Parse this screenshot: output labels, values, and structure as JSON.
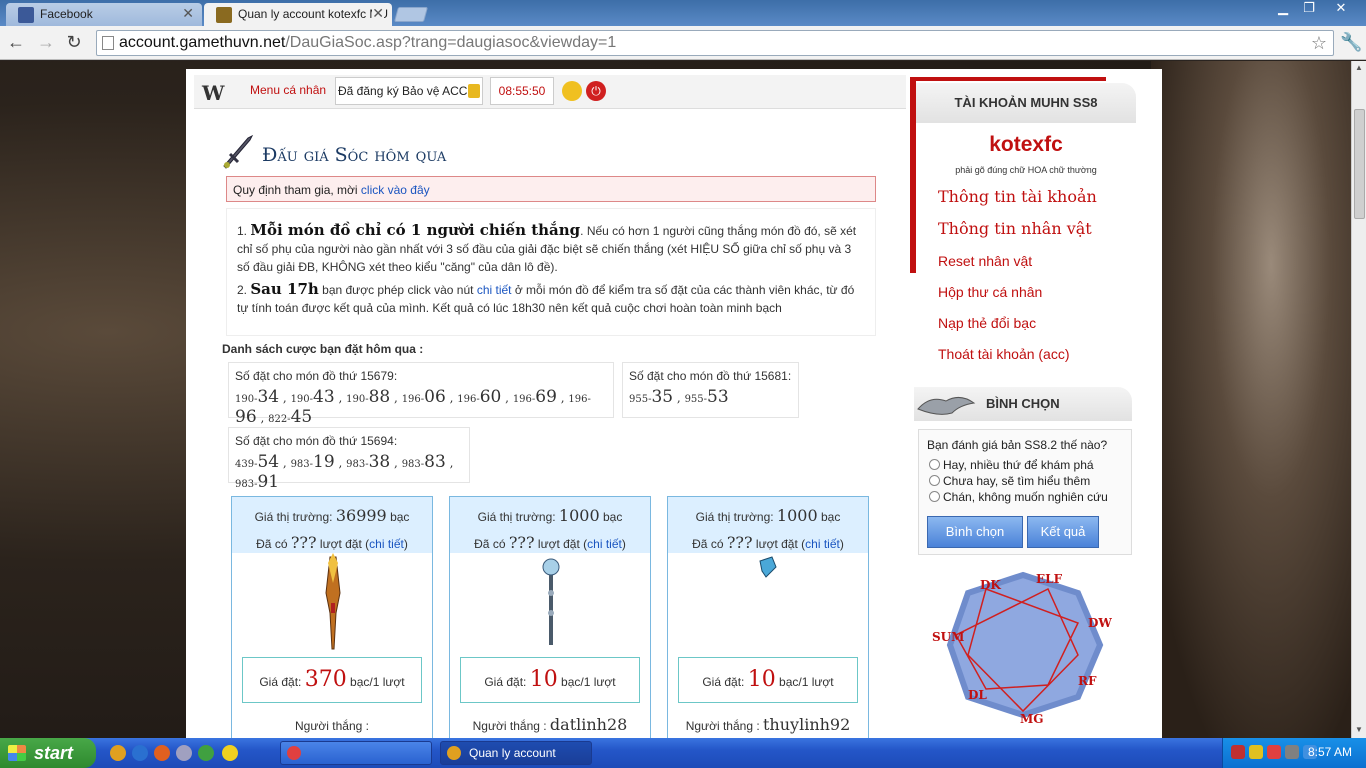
{
  "browser": {
    "tabs": [
      {
        "title": "Facebook",
        "active": false
      },
      {
        "title": "Quan ly account kotexfc MU",
        "active": true
      }
    ],
    "url_host": "account.gamethuvn.net",
    "url_path": "/DauGiaSoc.asp?trang=daugiasoc&viewday=1"
  },
  "topbar": {
    "logo": "W",
    "menu_label": "Menu cá nhân",
    "register_text": "Đã đăng ký Bảo vệ ACC",
    "clock": "08:55:50"
  },
  "page": {
    "title": "Đấu giá Sóc hôm qua",
    "rule_text": "Quy định tham gia, mời ",
    "rule_link": "click vào đây",
    "info": {
      "p1_num": "1. ",
      "p1_big": "Mỗi món đồ chỉ có 1 người chiến thắng",
      "p1_text": ". Nếu có hơn 1 người cũng thắng món đồ đó, sẽ xét chỉ số phụ của người nào gần nhất với 3 số đầu của giải đặc biệt sẽ chiến thắng (xét HIỆU SỐ giữa chỉ số phụ và 3 số đầu giải ĐB, KHÔNG xét theo kiểu \"căng\" của dân lô đề).",
      "p2_num": "2. ",
      "p2_big": "Sau 17h",
      "p2_text_a": " bạn được phép click vào nút ",
      "p2_link": "chi tiết",
      "p2_text_b": " ở mỗi món đồ để kiểm tra số đặt của các thành viên khác, từ đó tự tính toán được kết quả của mình. Kết quả có lúc 18h30 nên kết quả cuộc chơi hoàn toàn minh bạch"
    },
    "list_title": "Danh sách cược bạn đặt hôm qua :",
    "bids": [
      {
        "label": "Số đặt cho món đồ thứ 15679:",
        "nums": [
          [
            "190-",
            "34"
          ],
          [
            "190-",
            "43"
          ],
          [
            "190-",
            "88"
          ],
          [
            "196-",
            "06"
          ],
          [
            "196-",
            "60"
          ],
          [
            "196-",
            "69"
          ],
          [
            "196-",
            "96"
          ],
          [
            "822-",
            "45"
          ]
        ]
      },
      {
        "label": "Số đặt cho món đồ thứ 15681:",
        "nums": [
          [
            "955-",
            "35"
          ],
          [
            "955-",
            "53"
          ]
        ]
      },
      {
        "label": "Số đặt cho món đồ thứ 15694:",
        "nums": [
          [
            "439-",
            "54"
          ],
          [
            "983-",
            "19"
          ],
          [
            "983-",
            "38"
          ],
          [
            "983-",
            "83"
          ],
          [
            "983-",
            "91"
          ]
        ]
      }
    ],
    "items": [
      {
        "market_label": "Giá thị trường: ",
        "market_value": "36999",
        "unit": " bạc",
        "count_pre": "Đã có ",
        "count": "???",
        "count_post": " lượt đặt (",
        "detail": "chi tiết",
        "close": ")",
        "price_label": "Giá đặt: ",
        "price": "370",
        "price_unit": " bạc/1 lượt",
        "winner_label": "Người thắng : ",
        "winner": ""
      },
      {
        "market_label": "Giá thị trường: ",
        "market_value": "1000",
        "unit": " bạc",
        "count_pre": "Đã có ",
        "count": "???",
        "count_post": " lượt đặt (",
        "detail": "chi tiết",
        "close": ")",
        "price_label": "Giá đặt: ",
        "price": "10",
        "price_unit": " bạc/1 lượt",
        "winner_label": "Người thắng : ",
        "winner": "datlinh28"
      },
      {
        "market_label": "Giá thị trường: ",
        "market_value": "1000",
        "unit": " bạc",
        "count_pre": "Đã có ",
        "count": "???",
        "count_post": " lượt đặt (",
        "detail": "chi tiết",
        "close": ")",
        "price_label": "Giá đặt: ",
        "price": "10",
        "price_unit": " bạc/1 lượt",
        "winner_label": "Người thắng : ",
        "winner": "thuylinh92"
      }
    ]
  },
  "sidebar": {
    "account_title": "TÀI KHOẢN MUHN SS8",
    "username": "kotexfc",
    "hint": "phải gõ đúng chữ HOA chữ thường",
    "links": [
      "Thông tin tài khoản",
      "Thông tin nhân vật",
      "Reset nhân vật",
      "Hộp thư cá nhân",
      "Nạp thẻ đổi bạc",
      "Thoát tài khoản (acc)"
    ],
    "vote_title": "BÌNH CHỌN",
    "vote_question": "Bạn đánh giá bản SS8.2 thế nào?",
    "vote_options": [
      "Hay, nhiều thứ để khám phá",
      "Chưa hay, sẽ tìm hiểu thêm",
      "Chán, không muốn nghiên cứu"
    ],
    "vote_button": "Bình chọn",
    "result_button": "Kết quả",
    "classes": [
      "DK",
      "ELF",
      "DW",
      "RF",
      "MG",
      "DL",
      "SUM"
    ]
  },
  "taskbar": {
    "start": "start",
    "task_label": "Quan ly account kote...",
    "time": "8:57 AM"
  },
  "colors": {
    "accent_red": "#c01010",
    "link_blue": "#1a55c0",
    "title_navy": "#1b3a63"
  }
}
